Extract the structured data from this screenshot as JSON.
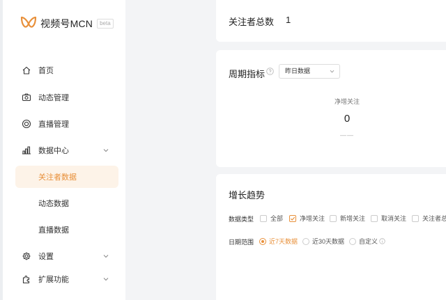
{
  "app": {
    "name": "视频号MCN",
    "badge": "beta"
  },
  "sidebar": {
    "items": [
      {
        "label": "首页",
        "icon": "home-icon"
      },
      {
        "label": "动态管理",
        "icon": "camera-icon"
      },
      {
        "label": "直播管理",
        "icon": "live-icon"
      },
      {
        "label": "数据中心",
        "icon": "bar-chart-icon",
        "expanded": true,
        "children": [
          {
            "label": "关注者数据",
            "active": true
          },
          {
            "label": "动态数据"
          },
          {
            "label": "直播数据"
          }
        ]
      },
      {
        "label": "设置",
        "icon": "gear-icon"
      },
      {
        "label": "扩展功能",
        "icon": "puzzle-icon"
      }
    ]
  },
  "followers_total": {
    "label": "关注者总数",
    "value": "1"
  },
  "period": {
    "title": "周期指标",
    "selected": "昨日数据",
    "metric_label": "净增关注",
    "metric_value": "0",
    "metric_sub": "——"
  },
  "trend": {
    "title": "增长趋势",
    "data_type_label": "数据类型",
    "data_types": [
      {
        "label": "全部",
        "checked": false
      },
      {
        "label": "净增关注",
        "checked": true
      },
      {
        "label": "新增关注",
        "checked": false
      },
      {
        "label": "取消关注",
        "checked": false
      },
      {
        "label": "关注者总",
        "checked": false
      }
    ],
    "date_range_label": "日期范围",
    "date_ranges": [
      {
        "label": "近7天数据",
        "checked": true
      },
      {
        "label": "近30天数据",
        "checked": false
      },
      {
        "label": "自定义",
        "checked": false
      }
    ]
  },
  "colors": {
    "accent": "#e8903a",
    "active_bg": "#fdf3e8",
    "page_bg": "#f3f4f6"
  }
}
